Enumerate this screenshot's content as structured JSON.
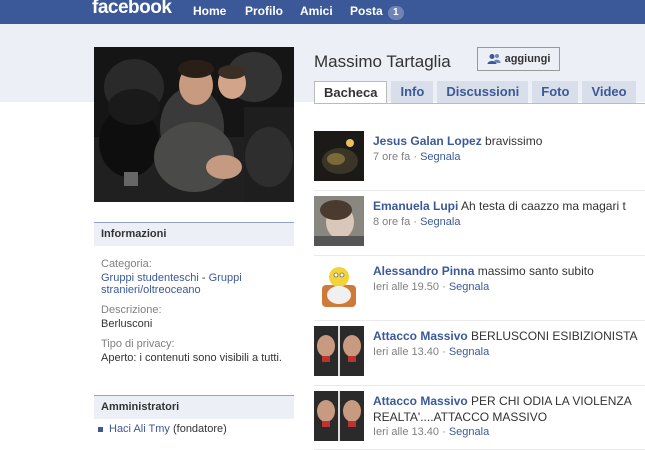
{
  "topbar": {
    "logo": "facebook",
    "nav": [
      "Home",
      "Profilo",
      "Amici",
      "Posta"
    ],
    "mail_count": "1"
  },
  "profile": {
    "name": "Massimo Tartaglia",
    "add_label": "aggiungi"
  },
  "tabs": [
    "Bacheca",
    "Info",
    "Discussioni",
    "Foto",
    "Video"
  ],
  "info_box": {
    "title": "Informazioni",
    "category_label": "Categoria:",
    "category_link1": "Gruppi studenteschi",
    "category_sep": " - ",
    "category_link2": "Gruppi stranieri/oltreoceano",
    "description_label": "Descrizione:",
    "description_value": "Berlusconi",
    "privacy_label": "Tipo di privacy:",
    "privacy_value": "Aperto: i contenuti sono visibili a tutti."
  },
  "admins_box": {
    "title": "Amministratori",
    "admin_name": "Haci Ali Tmy",
    "admin_role": " (fondatore)"
  },
  "feed": [
    {
      "author": "Jesus Galan Lopez",
      "message": " bravissimo",
      "time": "7 ore fa",
      "sep": " · ",
      "report": "Segnala"
    },
    {
      "author": "Emanuela Lupi",
      "message": " Ah testa di caazzo ma magari t",
      "time": "8 ore fa",
      "sep": " · ",
      "report": "Segnala"
    },
    {
      "author": "Alessandro Pinna",
      "message": " massimo santo subito",
      "time": "Ieri alle 19.50",
      "sep": " · ",
      "report": "Segnala"
    },
    {
      "author": "Attacco Massivo",
      "message": " BERLUSCONI ESIBIZIONISTA",
      "time": "Ieri alle 13.40",
      "sep": " · ",
      "report": "Segnala"
    },
    {
      "author": "Attacco Massivo",
      "message": " PER CHI ODIA LA VIOLENZA REALTA'....ATTACCO MASSIVO",
      "time": "Ieri alle 13.40",
      "sep": " · ",
      "report": "Segnala"
    }
  ],
  "colors": {
    "brand": "#3b5998",
    "tab_bg": "#d8dfea",
    "band": "#eceff5"
  }
}
